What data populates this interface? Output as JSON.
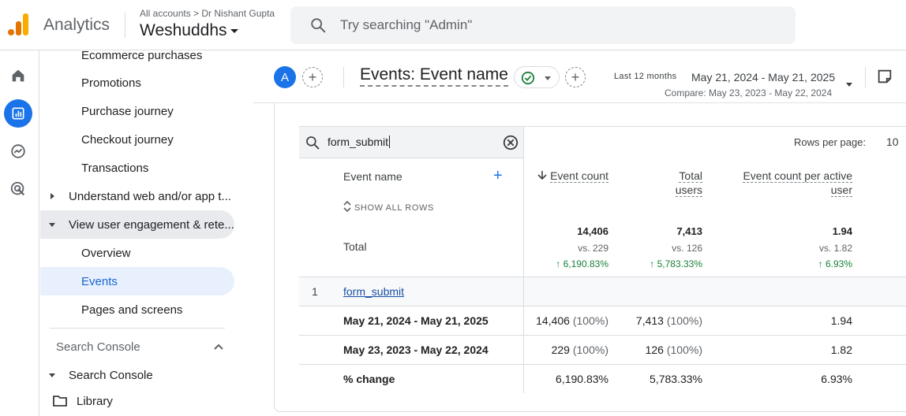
{
  "header": {
    "product_name": "Analytics",
    "account_breadcrumb": "All accounts > Dr Nishant Gupta",
    "property_name": "Weshuddhs",
    "search_placeholder": "Try searching \"Admin\""
  },
  "rail": {
    "items": [
      "home-icon",
      "reports-icon",
      "explore-icon",
      "advertising-icon"
    ],
    "active": "reports-icon"
  },
  "sidenav": {
    "items": [
      {
        "label": "Ecommerce purchases",
        "kind": "sub"
      },
      {
        "label": "Promotions",
        "kind": "sub"
      },
      {
        "label": "Purchase journey",
        "kind": "sub"
      },
      {
        "label": "Checkout journey",
        "kind": "sub"
      },
      {
        "label": "Transactions",
        "kind": "sub"
      },
      {
        "label": "Understand web and/or app t...",
        "kind": "group-collapsed"
      },
      {
        "label": "View user engagement & rete...",
        "kind": "group-expanded"
      },
      {
        "label": "Overview",
        "kind": "sub"
      },
      {
        "label": "Events",
        "kind": "sub-selected"
      },
      {
        "label": "Pages and screens",
        "kind": "sub"
      }
    ],
    "section_header": "Search Console",
    "search_console_item": "Search Console",
    "library_item": "Library"
  },
  "report": {
    "avatar_letter": "A",
    "title": "Events: Event name",
    "period_label": "Last 12 months",
    "date_range": "May 21, 2024 - May 21, 2025",
    "compare_range": "Compare: May 23, 2023 - May 22, 2024"
  },
  "table": {
    "search_value": "form_submit",
    "rows_per_page_label": "Rows per page:",
    "rows_per_page_value": "10",
    "dimension_header": "Event name",
    "show_all_rows": "SHOW ALL ROWS",
    "metric_headers": {
      "event_count": "Event count",
      "total_users_line1": "Total",
      "total_users_line2": "users",
      "per_user_line1": "Event count per active",
      "per_user_line2": "user"
    },
    "total": {
      "label": "Total",
      "event_count": "14,406",
      "event_count_vs": "vs. 229",
      "event_count_change": "↑ 6,190.83%",
      "total_users": "7,413",
      "total_users_vs": "vs. 126",
      "total_users_change": "↑ 5,783.33%",
      "per_user": "1.94",
      "per_user_vs": "vs. 1.82",
      "per_user_change": "↑ 6.93%"
    },
    "row": {
      "index": "1",
      "event_name": "form_submit",
      "current": {
        "label": "May 21, 2024 - May 21, 2025",
        "event_count": "14,406",
        "event_count_pct": "(100%)",
        "total_users": "7,413",
        "total_users_pct": "(100%)",
        "per_user": "1.94"
      },
      "previous": {
        "label": "May 23, 2023 - May 22, 2024",
        "event_count": "229",
        "event_count_pct": "(100%)",
        "total_users": "126",
        "total_users_pct": "(100%)",
        "per_user": "1.82"
      },
      "change": {
        "label": "% change",
        "event_count": "6,190.83%",
        "total_users": "5,783.33%",
        "per_user": "6.93%"
      }
    }
  },
  "colors": {
    "accent": "#1a73e8",
    "positive": "#188038",
    "brand_orange": "#e37400",
    "brand_yellow": "#f9ab00"
  }
}
